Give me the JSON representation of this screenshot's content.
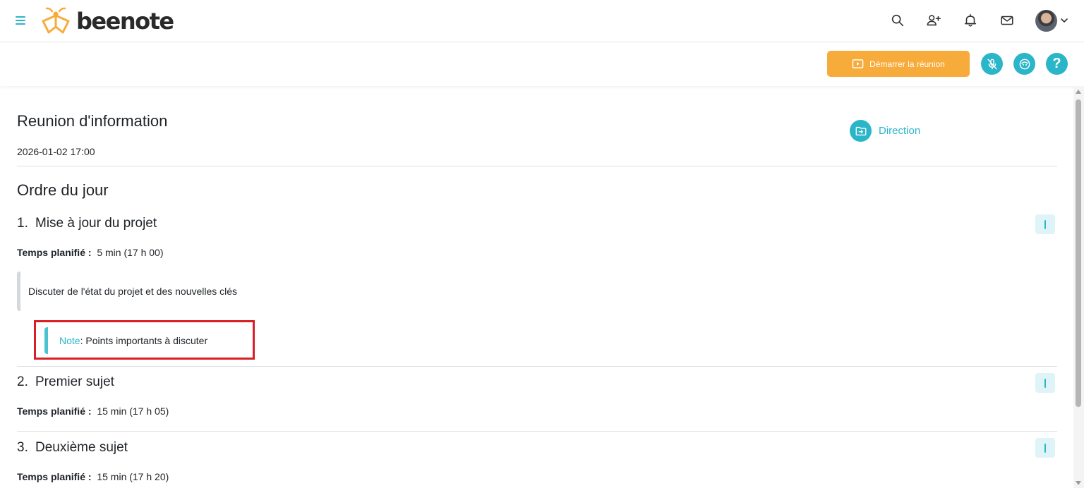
{
  "app": {
    "logo_text": "beenote",
    "brand_color": "#2bb5c8",
    "accent_color": "#f7ab3a"
  },
  "topbar": {
    "icons": [
      "menu-icon",
      "search-icon",
      "add-user-icon",
      "bell-icon",
      "mail-icon",
      "avatar",
      "chevron-down-icon"
    ]
  },
  "actionbar": {
    "start_meeting_label": "Démarrer la réunion",
    "help_label": "?"
  },
  "meeting": {
    "title": "Reunion d'information",
    "datetime": "2026-01-02 17:00",
    "folder_label": "Direction"
  },
  "agenda": {
    "title": "Ordre du jour",
    "planned_label": "Temps planifié :",
    "items": [
      {
        "number": "1.",
        "title": "Mise à jour du projet",
        "planned": "5 min (17 h 00)",
        "description": "Discuter de l'état du projet et des nouvelles clés",
        "note_label": "Note",
        "note_text": " : Points importants à discuter"
      },
      {
        "number": "2.",
        "title": "Premier sujet",
        "planned": "15 min (17 h 05)"
      },
      {
        "number": "3.",
        "title": "Deuxième sujet",
        "planned": "15 min (17 h 20)"
      }
    ]
  }
}
